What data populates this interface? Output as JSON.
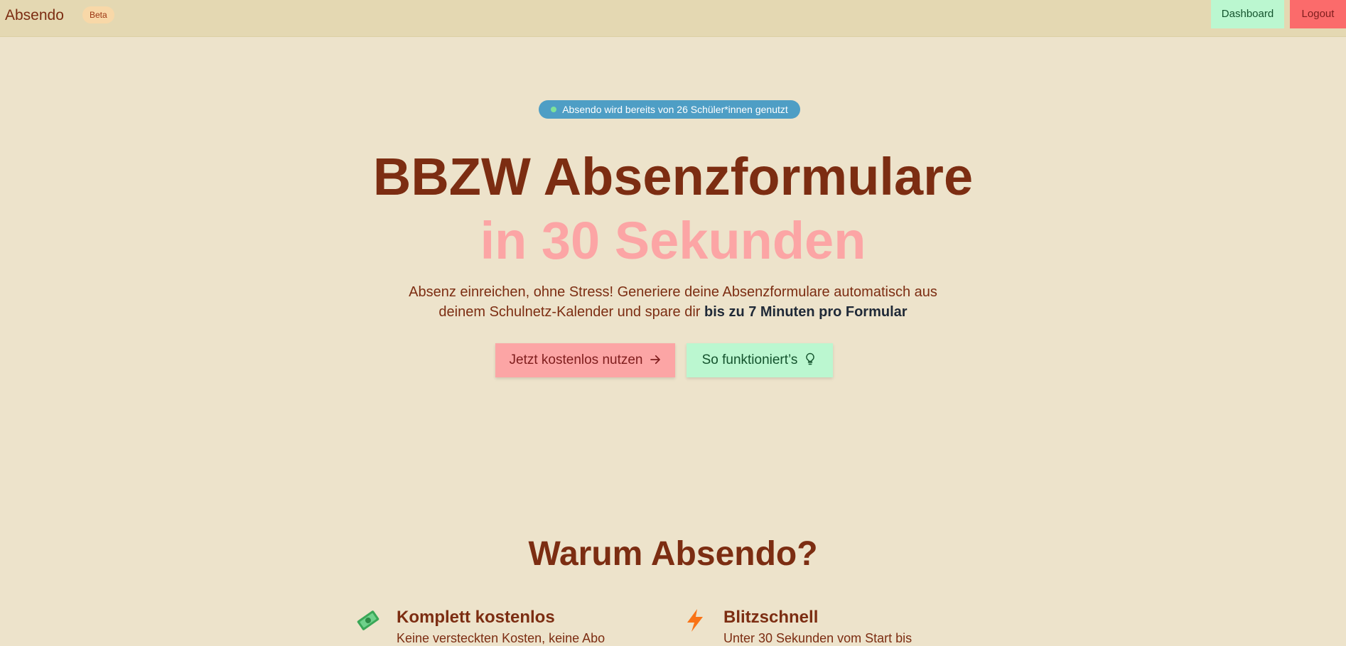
{
  "navbar": {
    "brand": "Absendo",
    "badge": "Beta",
    "dashboard_label": "Dashboard",
    "logout_label": "Logout"
  },
  "hero": {
    "pill_text": "Absendo wird bereits von 26 Schüler*innen genutzt",
    "title_line1": "BBZW Absenzformulare",
    "title_line2": "in 30 Sekunden",
    "subtitle_part1": "Absenz einreichen, ohne Stress! Generiere deine Absenzformulare automatisch aus deinem Schulnetz-Kalender und spare dir ",
    "subtitle_bold": "bis zu 7 Minuten pro Formular",
    "cta_primary": "Jetzt kostenlos nutzen",
    "cta_secondary": "So funktioniert’s"
  },
  "why": {
    "title": "Warum Absendo?",
    "features": [
      {
        "icon": "money-icon",
        "title": "Komplett kostenlos",
        "text": "Keine versteckten Kosten, keine Abo"
      },
      {
        "icon": "lightning-icon",
        "title": "Blitzschnell",
        "text": "Unter 30 Sekunden vom Start bis"
      }
    ]
  },
  "colors": {
    "page_bg": "#ede3cb",
    "nav_bg": "#e4d8b2",
    "brown": "#7c2d12",
    "pink": "#fca5a5",
    "green": "#bbf7d0",
    "red": "#fb6b6b",
    "blue": "#4e9ec5"
  }
}
